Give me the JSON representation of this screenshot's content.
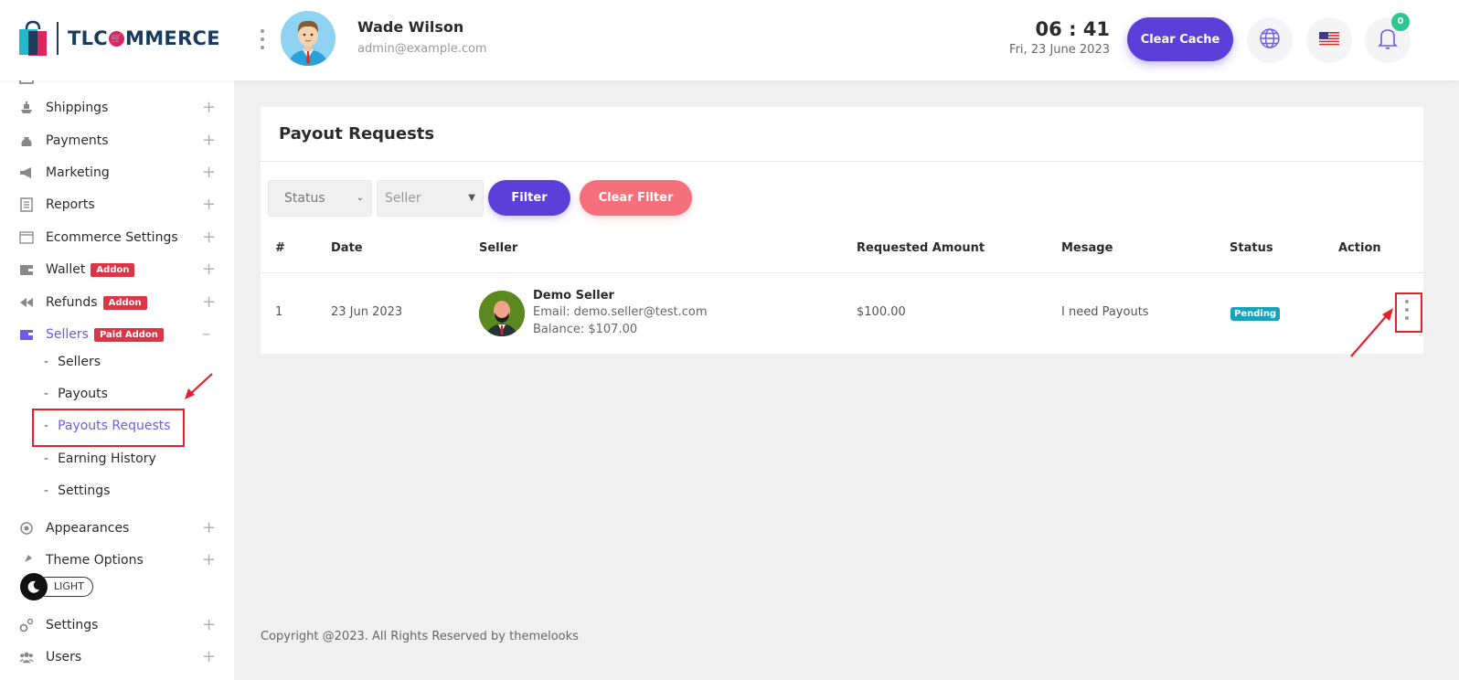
{
  "brand": {
    "logo_text_1": "TLC",
    "logo_text_2": "MMERCE",
    "logo_o": "🛒"
  },
  "user": {
    "name": "Wade Wilson",
    "email": "admin@example.com"
  },
  "header": {
    "time": "06 : 41",
    "date": "Fri, 23 June 2023",
    "clear_cache_label": "Clear Cache",
    "notification_count": "0"
  },
  "sidebar": {
    "items": [
      {
        "label": "Shippings",
        "icon": "ship-icon"
      },
      {
        "label": "Payments",
        "icon": "money-bag-icon"
      },
      {
        "label": "Marketing",
        "icon": "megaphone-icon"
      },
      {
        "label": "Reports",
        "icon": "report-icon"
      },
      {
        "label": "Ecommerce Settings",
        "icon": "window-icon"
      },
      {
        "label": "Wallet",
        "icon": "wallet-icon",
        "tag": "Addon"
      },
      {
        "label": "Refunds",
        "icon": "rewind-icon",
        "tag": "Addon"
      },
      {
        "label": "Sellers",
        "icon": "seller-icon",
        "tag": "Paid Addon"
      }
    ],
    "seller_sub": [
      {
        "label": "Sellers"
      },
      {
        "label": "Payouts"
      },
      {
        "label": "Payouts Requests"
      },
      {
        "label": "Earning History"
      },
      {
        "label": "Settings"
      }
    ],
    "items_after": [
      {
        "label": "Appearances",
        "icon": "appearance-icon"
      },
      {
        "label": "Theme Options",
        "icon": "paint-icon"
      },
      {
        "label": "Settings",
        "icon": "gears-icon"
      },
      {
        "label": "Users",
        "icon": "users-icon"
      }
    ],
    "theme_toggle_label": "LIGHT"
  },
  "page": {
    "title": "Payout Requests",
    "filters": {
      "status_placeholder": "Status",
      "seller_placeholder": "Seller",
      "filter_label": "Filter",
      "clear_label": "Clear Filter"
    },
    "columns": [
      "#",
      "Date",
      "Seller",
      "Requested Amount",
      "Mesage",
      "Status",
      "Action"
    ],
    "rows": [
      {
        "index": "1",
        "date": "23 Jun 2023",
        "seller_name": "Demo Seller",
        "seller_email": "Email: demo.seller@test.com",
        "seller_balance": "Balance: $107.00",
        "amount": "$100.00",
        "message": "I need Payouts",
        "status": "Pending"
      }
    ]
  },
  "footer": {
    "text": "Copyright @2023. All Rights Reserved by themelooks"
  },
  "colors": {
    "primary": "#5b3fd9",
    "danger": "#dc3545",
    "clear_filter": "#f5707a",
    "status_pending": "#17a2b8",
    "annotation_red": "#e5202a"
  }
}
